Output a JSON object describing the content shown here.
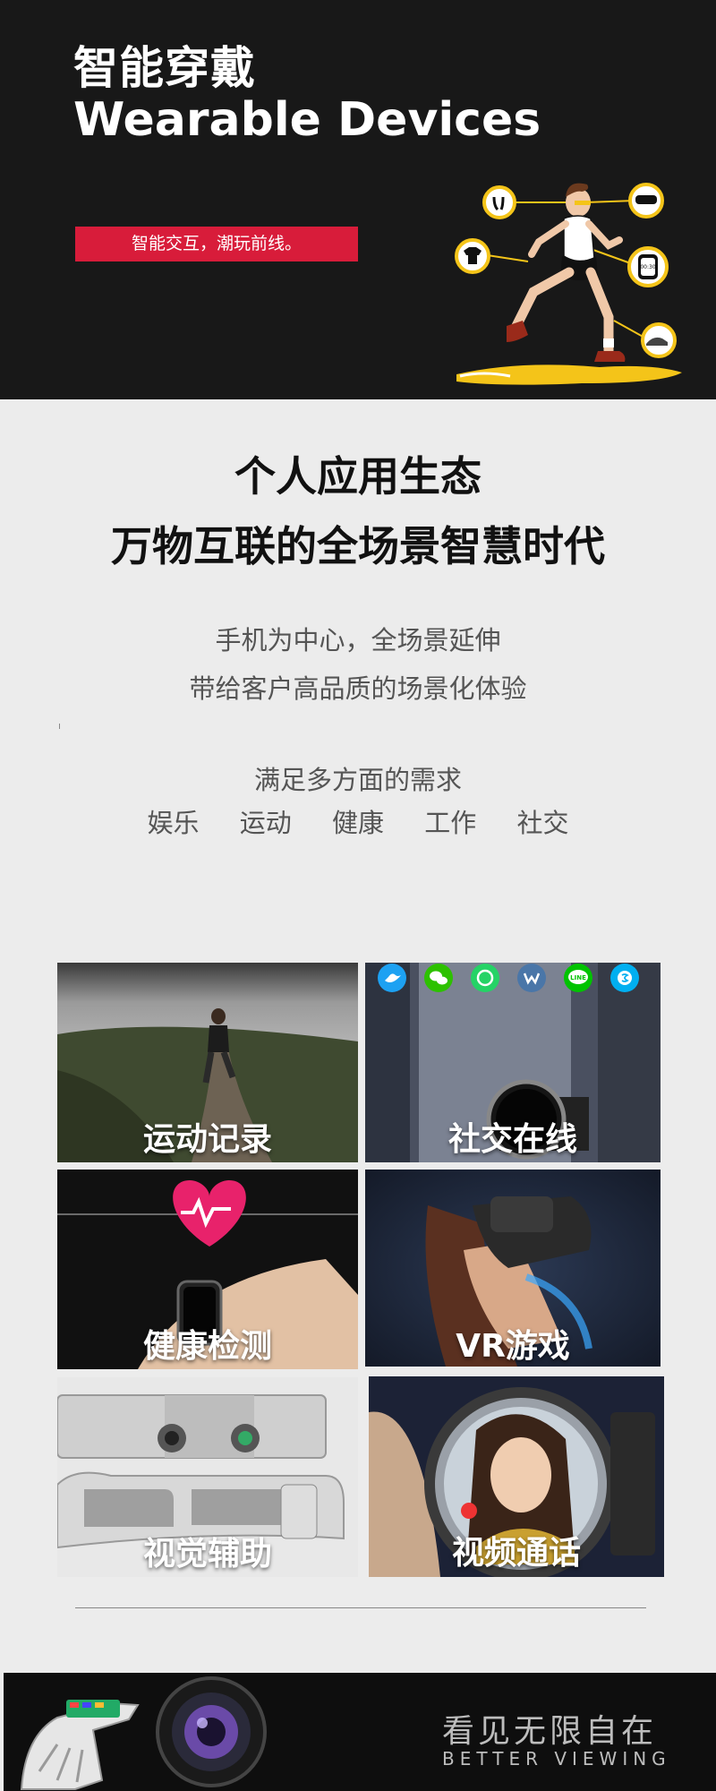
{
  "hero": {
    "title_cn": "智能穿戴",
    "title_en": "Wearable Devices",
    "tagline": "智能交互，潮玩前线。"
  },
  "ecosystem": {
    "heading_1": "个人应用生态",
    "heading_2": "万物互联的全场景智慧时代",
    "line_1": "手机为中心，全场景延伸",
    "line_2": "带给客户高品质的场景化体验",
    "line_3": "满足多方面的需求",
    "tags": [
      "娱乐",
      "运动",
      "健康",
      "工作",
      "社交"
    ]
  },
  "cards": [
    {
      "label": "运动记录"
    },
    {
      "label": "社交在线"
    },
    {
      "label": "健康检测"
    },
    {
      "label": "VR游戏"
    },
    {
      "label": "视觉辅助"
    },
    {
      "label": "视频通话"
    }
  ],
  "social_icons": [
    "twitter-icon",
    "wechat-icon",
    "whatsapp-icon",
    "vk-icon",
    "line-icon",
    "skype-icon"
  ],
  "social_icon_text": {
    "line": "LINE"
  },
  "watch_display": "00:30",
  "footer": {
    "title_cn": "看见无限自在",
    "title_en": "BETTER VIEWING"
  },
  "colors": {
    "accent_red": "#d81c3a",
    "hero_bg": "#181818",
    "page_bg": "#ececec"
  }
}
